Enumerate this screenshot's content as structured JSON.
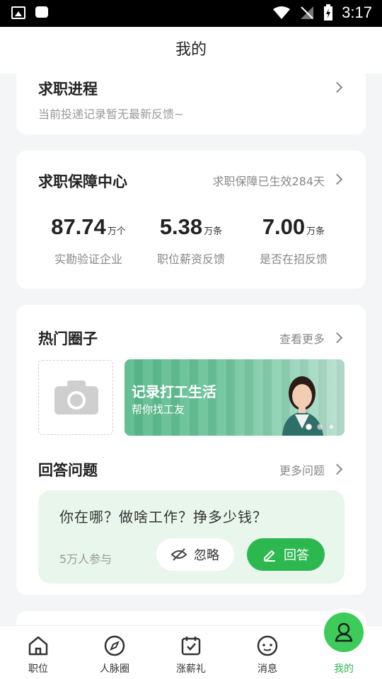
{
  "status_bar": {
    "time": "3:17"
  },
  "header": {
    "title": "我的"
  },
  "job_progress": {
    "title": "求职进程",
    "subtitle": "当前投递记录暂无最新反馈~"
  },
  "job_guarantee": {
    "title": "求职保障中心",
    "status_text": "求职保障已生效284天",
    "stats": [
      {
        "value": "87.74",
        "unit": "万个",
        "label": "实勘验证企业"
      },
      {
        "value": "5.38",
        "unit": "万条",
        "label": "职位薪资反馈"
      },
      {
        "value": "7.00",
        "unit": "万条",
        "label": "是否在招反馈"
      }
    ]
  },
  "hot_circles": {
    "title": "热门圈子",
    "more_label": "查看更多",
    "banner": {
      "title": "记录打工生活",
      "subtitle": "帮你找工友"
    }
  },
  "answer_questions": {
    "title": "回答问题",
    "more_label": "更多问题",
    "question": "你在哪？做啥工作？挣多少钱？",
    "participants": "5万人参与",
    "ignore_label": "忽略",
    "answer_label": "回答"
  },
  "bottom_nav": {
    "items": [
      {
        "label": "职位",
        "icon": "home-icon"
      },
      {
        "label": "人脉圈",
        "icon": "compass-icon"
      },
      {
        "label": "涨薪礼",
        "icon": "calendar-check-icon"
      },
      {
        "label": "消息",
        "icon": "chat-icon"
      },
      {
        "label": "我的",
        "icon": "profile-icon"
      }
    ],
    "active_index": 4
  },
  "colors": {
    "accent": "#2db84f",
    "qa_bg": "#e8f6ec",
    "page_bg": "#f4f5f7"
  }
}
